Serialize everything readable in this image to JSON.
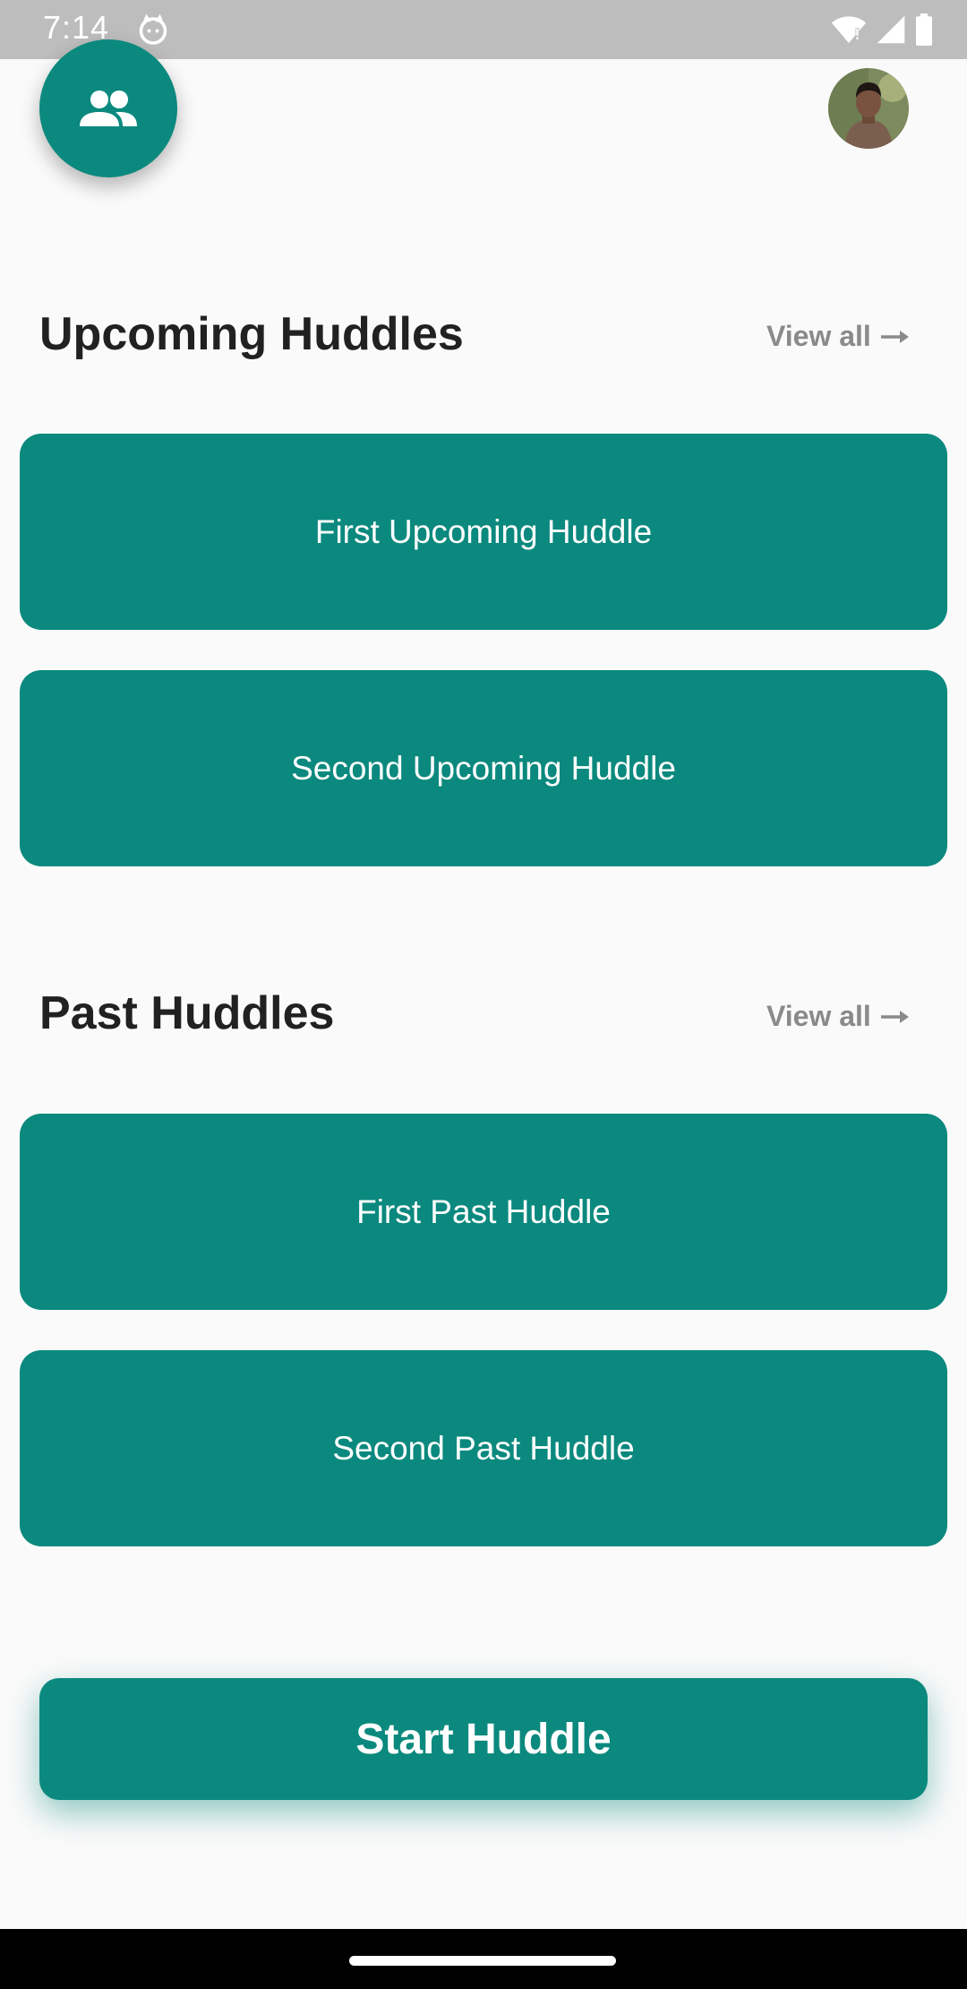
{
  "status_bar": {
    "time": "7:14",
    "icons": [
      "cat-notification-icon",
      "wifi-icon",
      "signal-icon",
      "battery-icon"
    ]
  },
  "header": {
    "group_button_icon": "people-icon",
    "avatar_icon": "user-avatar"
  },
  "upcoming": {
    "title": "Upcoming Huddles",
    "view_all": "View all",
    "view_all_icon": "arrow-right-icon",
    "cards": [
      {
        "label": "First Upcoming Huddle"
      },
      {
        "label": "Second Upcoming Huddle"
      }
    ]
  },
  "past": {
    "title": "Past Huddles",
    "view_all": "View all",
    "view_all_icon": "arrow-right-icon",
    "cards": [
      {
        "label": "First Past Huddle"
      },
      {
        "label": "Second Past Huddle"
      }
    ]
  },
  "actions": {
    "start_label": "Start Huddle"
  },
  "colors": {
    "accent": "#0b897e",
    "background": "#fafafa",
    "heading": "#212121",
    "muted": "#8a8a8a"
  }
}
